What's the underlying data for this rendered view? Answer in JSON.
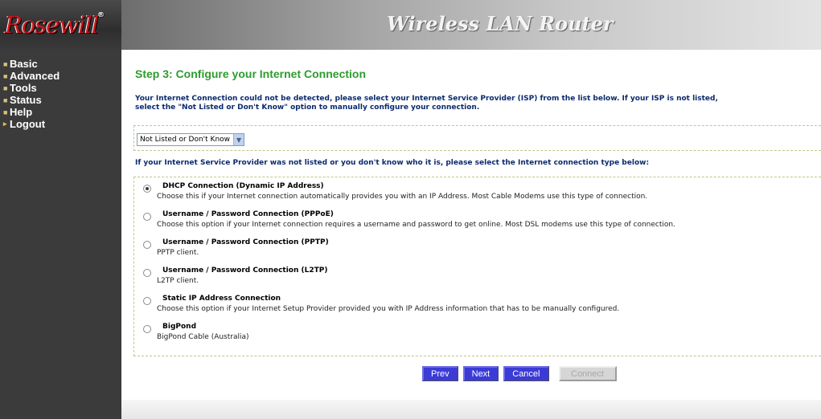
{
  "header": {
    "logo_text": "Rosewill",
    "logo_mark": "®",
    "title": "Wireless LAN Router"
  },
  "sidebar": {
    "items": [
      {
        "label": "Basic"
      },
      {
        "label": "Advanced"
      },
      {
        "label": "Tools"
      },
      {
        "label": "Status"
      },
      {
        "label": "Help"
      },
      {
        "label": "Logout"
      }
    ]
  },
  "main": {
    "step_title": "Step 3: Configure your Internet Connection",
    "intro_line1": "Your Internet Connection could not be detected, please select your Internet Service Provider (ISP) from the list below. If your ISP is not listed,",
    "intro_line2": "select the \"Not Listed or Don't Know\" option to manually configure your connection.",
    "isp_select_value": "Not Listed or Don't Know",
    "connection_prompt": "If your Internet Service Provider was not listed or you don't know who it is, please select the Internet connection type below:",
    "options": [
      {
        "title": "DHCP Connection (Dynamic IP Address)",
        "desc": "Choose this if your Internet connection automatically provides you with an IP Address. Most Cable Modems use this type of connection.",
        "checked": true
      },
      {
        "title": "Username / Password Connection (PPPoE)",
        "desc": "Choose this option if your Internet connection requires a username and password to get online. Most DSL modems use this type of connection.",
        "checked": false
      },
      {
        "title": "Username / Password Connection (PPTP)",
        "desc": "PPTP client.",
        "checked": false
      },
      {
        "title": "Username / Password Connection (L2TP)",
        "desc": "L2TP client.",
        "checked": false
      },
      {
        "title": "Static IP Address Connection",
        "desc": "Choose this option if your Internet Setup Provider provided you with IP Address information that has to be manually configured.",
        "checked": false
      },
      {
        "title": "BigPond",
        "desc": "BigPond Cable (Australia)",
        "checked": false
      }
    ],
    "buttons": {
      "prev": "Prev",
      "next": "Next",
      "cancel": "Cancel",
      "connect": "Connect"
    }
  },
  "colors": {
    "step_title": "#2d9c2d",
    "text_blue": "#0b2a6e",
    "button_blue": "#3b3bd6",
    "sidebar_bg": "#3b3b3b",
    "logo_red": "#c8161d"
  }
}
